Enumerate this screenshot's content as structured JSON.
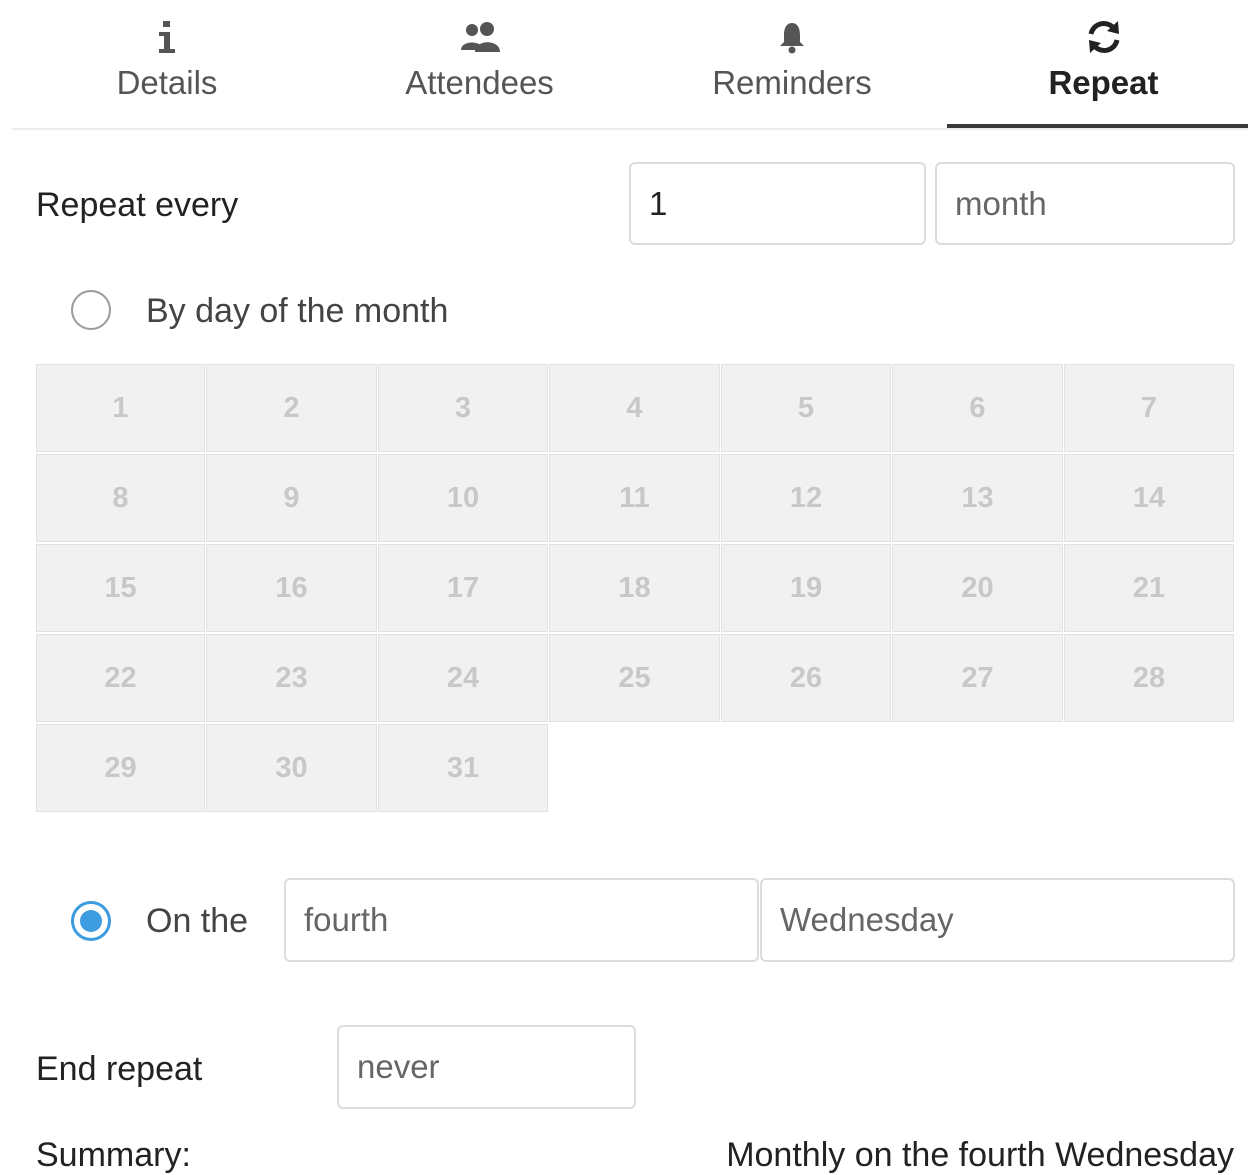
{
  "tabs": [
    {
      "label": "Details",
      "icon": "info-icon"
    },
    {
      "label": "Attendees",
      "icon": "people-icon"
    },
    {
      "label": "Reminders",
      "icon": "bell-icon"
    },
    {
      "label": "Repeat",
      "icon": "refresh-icon",
      "active": true
    }
  ],
  "repeat_every": {
    "label": "Repeat every",
    "count": "1",
    "unit": "month"
  },
  "by_day": {
    "label": "By day of the month",
    "selected": false,
    "days": [
      "1",
      "2",
      "3",
      "4",
      "5",
      "6",
      "7",
      "8",
      "9",
      "10",
      "11",
      "12",
      "13",
      "14",
      "15",
      "16",
      "17",
      "18",
      "19",
      "20",
      "21",
      "22",
      "23",
      "24",
      "25",
      "26",
      "27",
      "28",
      "29",
      "30",
      "31"
    ]
  },
  "on_the": {
    "label": "On the",
    "selected": true,
    "ordinal": "fourth",
    "weekday": "Wednesday"
  },
  "end_repeat": {
    "label": "End repeat",
    "value": "never"
  },
  "summary": {
    "label": "Summary:",
    "text": "Monthly on the fourth Wednesday"
  },
  "colors": {
    "accent": "#3d9be0",
    "day_cell_bg": "#f1f1f1",
    "day_text": "#c8c8c8"
  }
}
